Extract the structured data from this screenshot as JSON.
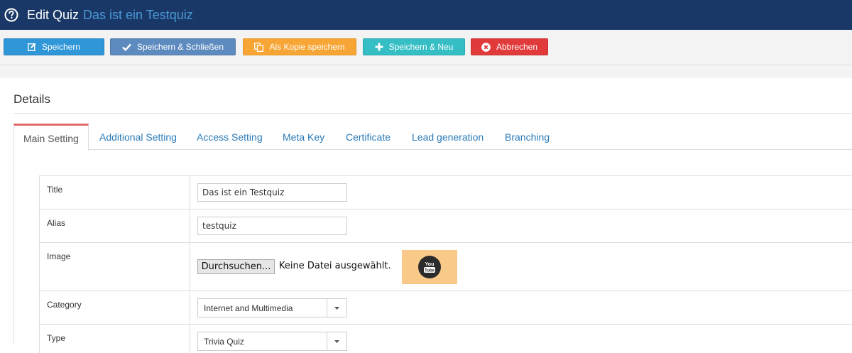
{
  "header": {
    "title": "Edit Quiz",
    "subtitle": "Das ist ein Testquiz"
  },
  "toolbar": {
    "save_label": "Speichern",
    "save_close_label": "Speichern & Schließen",
    "save_copy_label": "Als Kopie speichern",
    "save_new_label": "Speichern & Neu",
    "cancel_label": "Abbrechen"
  },
  "details": {
    "heading": "Details"
  },
  "tabs": [
    {
      "label": "Main Setting",
      "active": true
    },
    {
      "label": "Additional Setting",
      "active": false
    },
    {
      "label": "Access Setting",
      "active": false
    },
    {
      "label": "Meta Key",
      "active": false
    },
    {
      "label": "Certificate",
      "active": false
    },
    {
      "label": "Lead generation",
      "active": false
    },
    {
      "label": "Branching",
      "active": false
    }
  ],
  "form": {
    "title_label": "Title",
    "title_value": "Das ist ein Testquiz",
    "alias_label": "Alias",
    "alias_value": "testquiz",
    "image_label": "Image",
    "file_button_label": "Durchsuchen...",
    "file_status": "Keine Datei ausgewählt.",
    "image_thumb_text_top": "You",
    "image_thumb_text_bottom": "Tube",
    "category_label": "Category",
    "category_value": "Internet and Multimedia",
    "type_label": "Type",
    "type_value": "Trivia Quiz"
  },
  "icons": {
    "help": "help-circle-icon",
    "save": "edit-icon",
    "save_close": "check-icon",
    "save_copy": "copy-icon",
    "save_new": "plus-icon",
    "cancel": "cancel-circle-icon",
    "dropdown": "caret-down-icon"
  },
  "colors": {
    "header_bg": "#1a3867",
    "subtitle": "#4a98d6",
    "save": "#2f96d8",
    "save_close": "#5e8bbf",
    "save_copy": "#f7a534",
    "save_new": "#35bec4",
    "cancel": "#e03a3a",
    "tab_active_top": "#e06a6a",
    "tab_link": "#2a7ab8",
    "thumb_bg": "#f9c98a"
  }
}
